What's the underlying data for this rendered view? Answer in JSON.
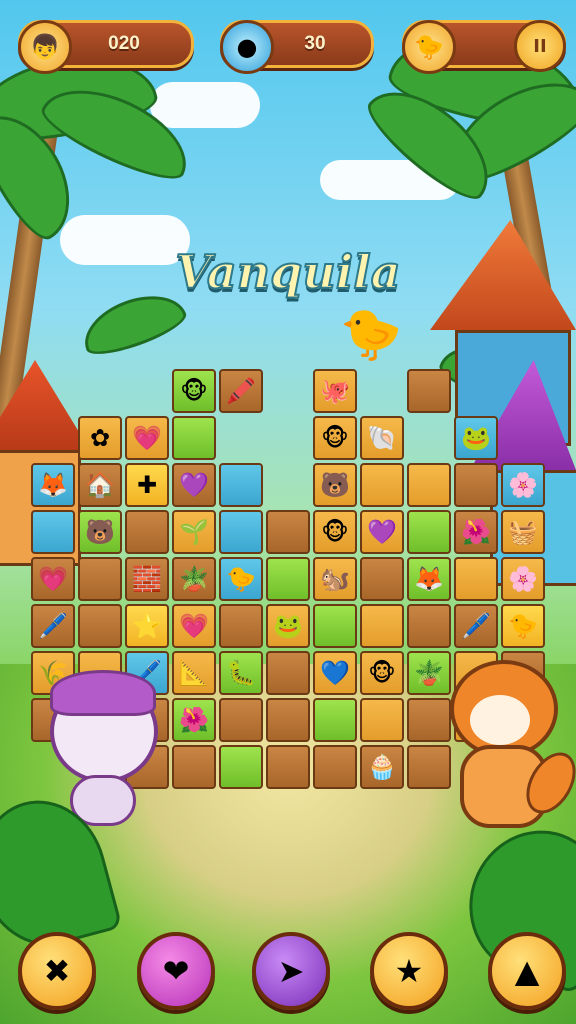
{
  "hud": {
    "lives": {
      "value": "020",
      "icon": "kid-face-icon"
    },
    "gems": {
      "value": "30",
      "icon": "blue-gem-icon"
    },
    "bird": {
      "value": "",
      "icon": "yellow-bird-icon"
    },
    "pause_label": "II"
  },
  "title": "Vanquila",
  "board": {
    "rows": [
      [
        null,
        null,
        null,
        {
          "c": "g",
          "i": "🐵"
        },
        {
          "c": "b",
          "i": "🖍️"
        },
        null,
        {
          "c": "o",
          "i": "🐙"
        },
        null,
        {
          "c": "b",
          "i": ""
        },
        null,
        null
      ],
      [
        null,
        {
          "c": "o",
          "i": "✿"
        },
        {
          "c": "o",
          "i": "💗"
        },
        {
          "c": "g",
          "i": ""
        },
        null,
        null,
        {
          "c": "o",
          "i": "🐵"
        },
        {
          "c": "o",
          "i": "🐚"
        },
        null,
        {
          "c": "t",
          "i": "🐸"
        },
        null
      ],
      [
        {
          "c": "t",
          "i": "🦊"
        },
        {
          "c": "b",
          "i": "🏠"
        },
        {
          "c": "y",
          "i": "✚"
        },
        {
          "c": "b",
          "i": "💜"
        },
        {
          "c": "t",
          "i": ""
        },
        null,
        {
          "c": "o",
          "i": "🐻"
        },
        {
          "c": "o",
          "i": ""
        },
        {
          "c": "o",
          "i": ""
        },
        {
          "c": "b",
          "i": ""
        },
        {
          "c": "t",
          "i": "🌸"
        }
      ],
      [
        {
          "c": "t",
          "i": ""
        },
        {
          "c": "g",
          "i": "🐻"
        },
        {
          "c": "b",
          "i": ""
        },
        {
          "c": "o",
          "i": "🌱"
        },
        {
          "c": "t",
          "i": ""
        },
        {
          "c": "b",
          "i": ""
        },
        {
          "c": "o",
          "i": "🐵"
        },
        {
          "c": "o",
          "i": "💜"
        },
        {
          "c": "g",
          "i": ""
        },
        {
          "c": "b",
          "i": "🌺"
        },
        {
          "c": "o",
          "i": "🧺"
        }
      ],
      [
        {
          "c": "b",
          "i": "💗"
        },
        {
          "c": "b",
          "i": ""
        },
        {
          "c": "b",
          "i": "🧱"
        },
        {
          "c": "b",
          "i": "🪴"
        },
        {
          "c": "t",
          "i": "🐤"
        },
        {
          "c": "g",
          "i": ""
        },
        {
          "c": "o",
          "i": "🐿️"
        },
        {
          "c": "b",
          "i": ""
        },
        {
          "c": "g",
          "i": "🦊"
        },
        {
          "c": "o",
          "i": ""
        },
        {
          "c": "o",
          "i": "🌸"
        }
      ],
      [
        {
          "c": "b",
          "i": "🖊️"
        },
        {
          "c": "b",
          "i": ""
        },
        {
          "c": "y",
          "i": "⭐"
        },
        {
          "c": "o",
          "i": "💗"
        },
        {
          "c": "b",
          "i": ""
        },
        {
          "c": "o",
          "i": "🐸"
        },
        {
          "c": "g",
          "i": ""
        },
        {
          "c": "o",
          "i": ""
        },
        {
          "c": "b",
          "i": ""
        },
        {
          "c": "b",
          "i": "🖊️"
        },
        {
          "c": "y",
          "i": "🐤"
        }
      ],
      [
        {
          "c": "o",
          "i": "🌾"
        },
        {
          "c": "o",
          "i": ""
        },
        {
          "c": "t",
          "i": "🖊️"
        },
        {
          "c": "o",
          "i": "📐"
        },
        {
          "c": "g",
          "i": "🐛"
        },
        {
          "c": "b",
          "i": ""
        },
        {
          "c": "o",
          "i": "💙"
        },
        {
          "c": "o",
          "i": "🐵"
        },
        {
          "c": "g",
          "i": "🪴"
        },
        {
          "c": "o",
          "i": ""
        },
        {
          "c": "b",
          "i": ""
        }
      ],
      [
        {
          "c": "b",
          "i": ""
        },
        {
          "c": "b",
          "i": ""
        },
        {
          "c": "b",
          "i": ""
        },
        {
          "c": "g",
          "i": "🌺"
        },
        {
          "c": "b",
          "i": ""
        },
        {
          "c": "b",
          "i": ""
        },
        {
          "c": "g",
          "i": ""
        },
        {
          "c": "o",
          "i": ""
        },
        {
          "c": "b",
          "i": ""
        },
        {
          "c": "o",
          "i": ""
        },
        {
          "c": "b",
          "i": ""
        }
      ],
      [
        null,
        null,
        {
          "c": "b",
          "i": ""
        },
        {
          "c": "b",
          "i": ""
        },
        {
          "c": "g",
          "i": ""
        },
        {
          "c": "b",
          "i": ""
        },
        {
          "c": "b",
          "i": ""
        },
        {
          "c": "b",
          "i": "🧁"
        },
        {
          "c": "b",
          "i": ""
        },
        null,
        null
      ]
    ]
  },
  "buttons": [
    {
      "name": "shuffle-button",
      "icon": "✖",
      "style": "b-orange"
    },
    {
      "name": "heart-button",
      "icon": "❤",
      "style": "b-pink"
    },
    {
      "name": "arrow-button",
      "icon": "➤",
      "style": "b-purple"
    },
    {
      "name": "star-button",
      "icon": "★",
      "style": "b-orange"
    },
    {
      "name": "hint-button",
      "icon": "▲",
      "style": "b-orange"
    }
  ],
  "colors": {
    "accent": "#f3b23a",
    "hud_bg": "#8a3a1a",
    "board_border": "#6b3a14"
  }
}
